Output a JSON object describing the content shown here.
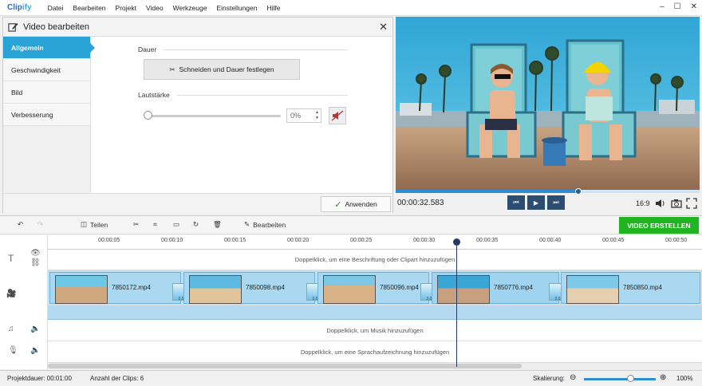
{
  "app": {
    "logo_a": "Clip",
    "logo_b": "ify"
  },
  "menu": [
    "Datei",
    "Bearbeiten",
    "Projekt",
    "Video",
    "Werkzeuge",
    "Einstellungen",
    "Hilfe"
  ],
  "window_controls": {
    "minimize": "–",
    "maximize": "☐",
    "close": "✕"
  },
  "panel": {
    "title": "Video bearbeiten",
    "close": "✕",
    "nav": [
      "Allgemein",
      "Geschwindigkeit",
      "Bild",
      "Verbesserung"
    ],
    "active_nav": "Allgemein",
    "duration_label": "Dauer",
    "cut_button": "Schneiden und Dauer festlegen",
    "volume_label": "Lautstärke",
    "volume_value": "0%",
    "apply_button": "Anwenden"
  },
  "player": {
    "timecode": "00:00:32.583",
    "aspect": "16:9",
    "progress": 0.6
  },
  "toolbar": {
    "split": "Teilen",
    "edit": "Bearbeiten",
    "create": "VIDEO ERSTELLEN"
  },
  "timeline": {
    "ticks": [
      "00:00:05",
      "00:00:10",
      "00:00:15",
      "00:00:20",
      "00:00:25",
      "00:00:30",
      "00:00:35",
      "00:00:40",
      "00:00:45",
      "00:00:50"
    ],
    "caption_hint": "Doppelklick, um eine Beschriftung oder Clipart hinzuzufügen",
    "music_hint": "Doppelklick, um Musik hinzuzufügen",
    "voice_hint": "Doppelklick, um eine Sprachaufzeichnung hinzuzufügen",
    "clips": [
      "7850172.mp4",
      "7850098.mp4",
      "7850096.mp4",
      "7850776.mp4",
      "7850850.mp4"
    ],
    "transition_label": "2.0"
  },
  "status": {
    "duration": "Projektdauer:  00:01:00",
    "clips": "Anzahl der Clips: 6",
    "zoom_label": "Skalierung:",
    "zoom_value": "100%"
  },
  "colors": {
    "accent": "#2aa3d6",
    "create": "#21b421",
    "playbar": "#2b4d72"
  }
}
